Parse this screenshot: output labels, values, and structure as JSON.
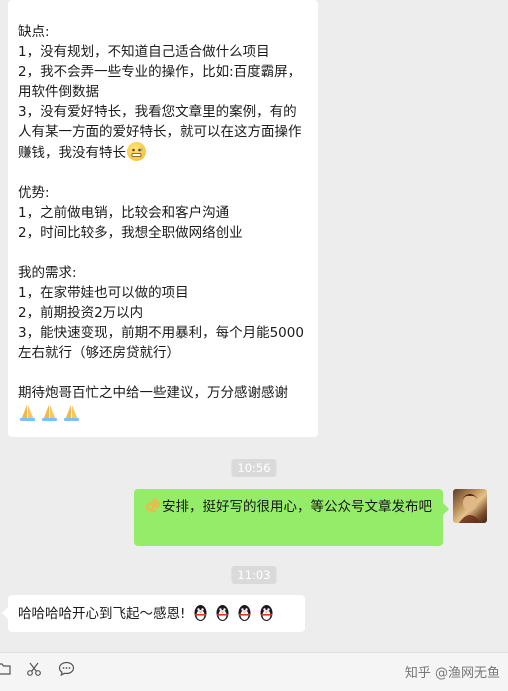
{
  "chat": {
    "incoming_message_1": {
      "lines": [
        "缺点:",
        "1，没有规划，不知道自己适合做什么项目",
        "2，我不会弄一些专业的操作，比如:百度霸屏，用软件倒数据",
        "3，没有爱好特长，我看您文章里的案例，有的人有某一方面的爱好特长，就可以在这方面操作赚钱，我没有特长",
        "",
        "优势:",
        "1，之前做电销，比较会和客户沟通",
        "2，时间比较多，我想全职做网络创业",
        "",
        "我的需求:",
        "1，在家带娃也可以做的项目",
        "2，前期投资2万以内",
        "3，能快速变现，前期不用暴利，每个月能5000左右就行（够还房贷就行）",
        "",
        "期待炮哥百忙之中给一些建议，万分感谢感谢"
      ],
      "line1_text": "缺点:\n1，没有规划，不知道自己适合做什么项目\n2，我不会弄一些专业的操作，比如:百度霸屏，用软件倒数据\n3，没有爱好特长，我看您文章里的案例，有的人有某一方面的爱好特长，就可以在这方面操作赚钱，我没有特长",
      "line2_text": "\n\n优势:\n1，之前做电销，比较会和客户沟通\n2，时间比较多，我想全职做网络创业\n\n我的需求:\n1，在家带娃也可以做的项目\n2，前期投资2万以内\n3，能快速变现，前期不用暴利，每个月能5000左右就行（够还房贷就行）\n\n期待炮哥百忙之中给一些建议，万分感谢感谢",
      "trailing_emojis": [
        "pray-emoji",
        "pray-emoji",
        "pray-emoji"
      ]
    },
    "timestamp_1": "10:56",
    "outgoing_message": {
      "leading_emoji": "ok-hand-emoji",
      "text": "安排，挺好写的很用心，等公众号文章发布吧"
    },
    "timestamp_2": "11:03",
    "incoming_message_2": {
      "text": "哈哈哈哈开心到飞起～感恩!",
      "trailing_emojis": [
        "penguin-emoji",
        "penguin-emoji",
        "penguin-emoji",
        "penguin-emoji"
      ]
    }
  },
  "toolbar": {
    "icons": [
      "folder-icon",
      "scissors-icon",
      "chat-bubble-icon"
    ],
    "watermark": "知乎 @渔网无鱼"
  },
  "colors": {
    "background": "#ededed",
    "incoming_bubble": "#ffffff",
    "outgoing_bubble": "#95ec69",
    "timestamp_bg": "#dadada"
  }
}
